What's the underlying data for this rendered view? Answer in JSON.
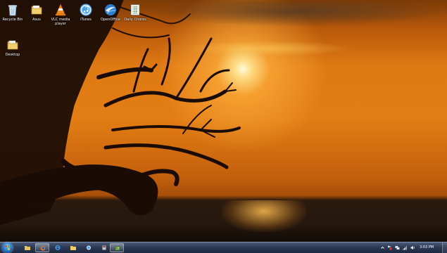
{
  "desktop": {
    "icons": [
      {
        "label": "Recycle Bin",
        "icon": "recycle-bin-icon"
      },
      {
        "label": "Asus",
        "icon": "folder-icon"
      },
      {
        "label": "VLC media player",
        "icon": "vlc-cone-icon"
      },
      {
        "label": "iTunes",
        "icon": "itunes-icon"
      },
      {
        "label": "OpenOffice",
        "icon": "openoffice-icon"
      },
      {
        "label": "Daily Chores",
        "icon": "spreadsheet-icon"
      },
      {
        "label": "Desktop",
        "icon": "folder-icon"
      }
    ]
  },
  "taskbar": {
    "start": {
      "icon": "windows-start-icon"
    },
    "pinned": [
      {
        "name": "explorer",
        "icon": "folder-icon",
        "active": false
      },
      {
        "name": "firefox",
        "icon": "firefox-icon",
        "active": true
      },
      {
        "name": "internet-explorer",
        "icon": "ie-icon",
        "active": false
      },
      {
        "name": "folder",
        "icon": "folder-icon",
        "active": false
      },
      {
        "name": "itunes",
        "icon": "itunes-icon",
        "active": false
      },
      {
        "name": "app",
        "icon": "app-icon",
        "active": false
      },
      {
        "name": "photo-viewer",
        "icon": "photo-icon",
        "active": true
      }
    ],
    "tray": {
      "icons": [
        "show-hidden-icon",
        "action-center-icon",
        "network-icon",
        "signal-icon",
        "volume-icon"
      ],
      "clock": "3:03 PM"
    }
  },
  "colors": {
    "sky": "#e27d14",
    "taskbar": "#2c3a55"
  }
}
